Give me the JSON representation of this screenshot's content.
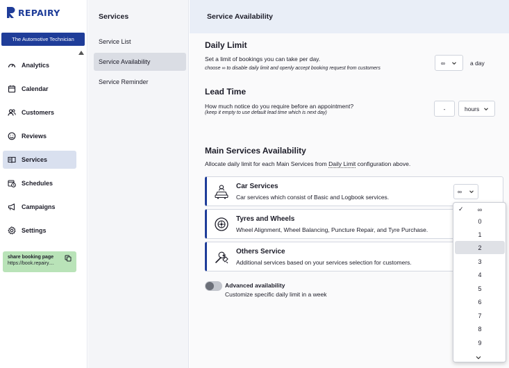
{
  "brand": {
    "name": "REPAIRY",
    "color": "#1f3d99"
  },
  "account": {
    "label": "The Automotive Technician"
  },
  "nav": {
    "items": [
      {
        "label": "Analytics",
        "icon": "gauge-icon"
      },
      {
        "label": "Calendar",
        "icon": "calendar-icon"
      },
      {
        "label": "Customers",
        "icon": "users-icon"
      },
      {
        "label": "Reviews",
        "icon": "smile-icon"
      },
      {
        "label": "Services",
        "icon": "book-icon",
        "active": true
      },
      {
        "label": "Schedules",
        "icon": "schedule-icon"
      },
      {
        "label": "Campaigns",
        "icon": "megaphone-icon"
      },
      {
        "label": "Settings",
        "icon": "gear-icon"
      }
    ]
  },
  "share": {
    "title": "share booking page",
    "url": "https://book.repairy....",
    "icon": "copy-icon"
  },
  "subnav": {
    "title": "Services",
    "items": [
      {
        "label": "Service List"
      },
      {
        "label": "Service Availability",
        "active": true
      },
      {
        "label": "Service Reminder"
      }
    ]
  },
  "main": {
    "header": "Service Availability",
    "daily_limit": {
      "title": "Daily Limit",
      "text": "Set a limit of bookings you can take per day.",
      "note": "choose ∞ to disable daily limit and openly accept booking request from customers",
      "value": "∞",
      "suffix": "a day"
    },
    "lead_time": {
      "title": "Lead Time",
      "text": "How much notice do you require before an appointment?",
      "note": "(keep it empty to use default lead time which is next day)",
      "value": "-",
      "unit": "hours"
    },
    "main_services": {
      "title": "Main Services Availability",
      "text_before": "Allocate daily limit for each Main Services from ",
      "link": "Daily Limit",
      "text_after": " configuration above.",
      "services": [
        {
          "name": "Car Services",
          "desc": "Car services which consist of Basic and Logbook services.",
          "icon": "car-service-icon",
          "limit": "∞"
        },
        {
          "name": "Tyres and Wheels",
          "desc": "Wheel Alignment, Wheel Balancing, Puncture Repair, and Tyre Purchase.",
          "icon": "tyre-icon"
        },
        {
          "name": "Others Service",
          "desc": "Additional services based on your services selection for customers.",
          "icon": "wrench-plug-icon"
        }
      ]
    },
    "advanced": {
      "title": "Advanced availability",
      "desc": "Customize specific daily limit in a week",
      "enabled": false
    }
  },
  "dropdown": {
    "options": [
      "∞",
      "0",
      "1",
      "2",
      "3",
      "4",
      "5",
      "6",
      "7",
      "8",
      "9"
    ],
    "checked": "∞",
    "highlighted": "2"
  }
}
